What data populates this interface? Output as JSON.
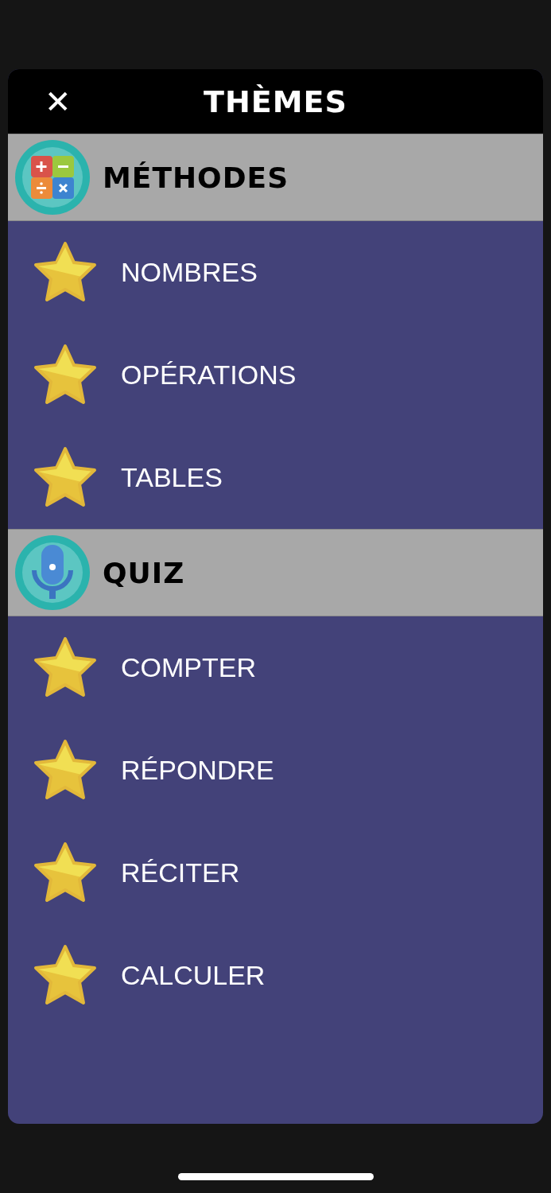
{
  "header": {
    "close": "✕",
    "title": "THÈMES"
  },
  "sections": [
    {
      "title": "MÉTHODES",
      "kind": "calculator",
      "items": [
        {
          "label": "NOMBRES"
        },
        {
          "label": "OPÉRATIONS"
        },
        {
          "label": "TABLES"
        }
      ]
    },
    {
      "title": "QUIZ",
      "kind": "microphone",
      "items": [
        {
          "label": "COMPTER"
        },
        {
          "label": "RÉPONDRE"
        },
        {
          "label": "RÉCITER"
        },
        {
          "label": "CALCULER"
        }
      ]
    }
  ]
}
